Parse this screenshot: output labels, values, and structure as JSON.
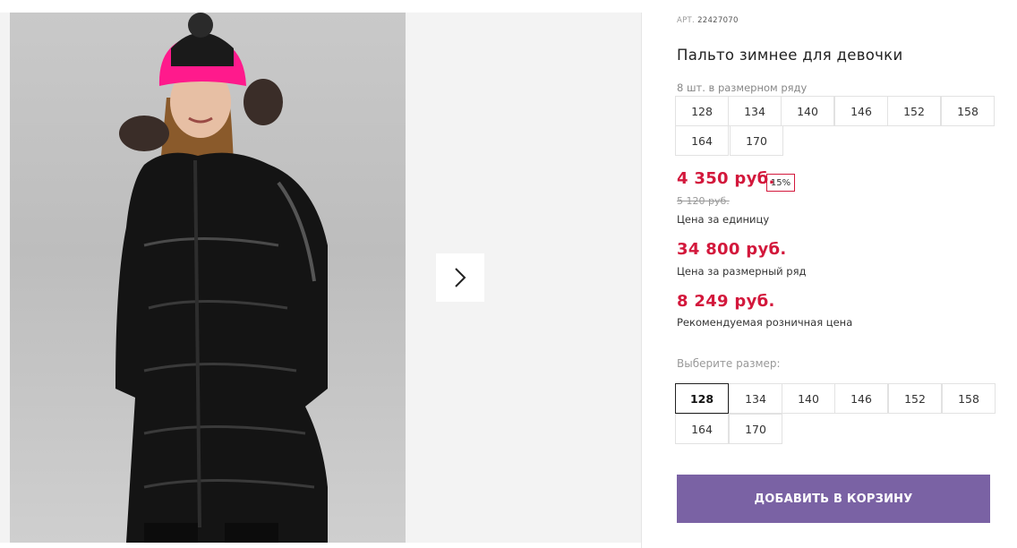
{
  "product": {
    "art_prefix": "АРТ.",
    "art_number": "22427070",
    "title": "Пальто зимнее для девочки",
    "pack_label": "8 шт. в размерном ряду",
    "pack_sizes": [
      "128",
      "134",
      "140",
      "146",
      "152",
      "158",
      "164",
      "170"
    ]
  },
  "prices": {
    "unit_price": "4 350 руб.",
    "discount": "15%",
    "old_price": "5 120 руб.",
    "unit_caption": "Цена за единицу",
    "pack_price": "34 800 руб.",
    "pack_caption": "Цена за размерный ряд",
    "retail_price": "8 249 руб.",
    "retail_caption": "Рекомендуемая розничная цена"
  },
  "size_select": {
    "label": "Выберите размер:",
    "sizes": [
      "128",
      "134",
      "140",
      "146",
      "152",
      "158",
      "164",
      "170"
    ],
    "selected": "128"
  },
  "cart": {
    "button_label": "ДОБАВИТЬ В КОРЗИНУ"
  },
  "colors": {
    "accent_price": "#d3183c",
    "button": "#7a62a4"
  }
}
